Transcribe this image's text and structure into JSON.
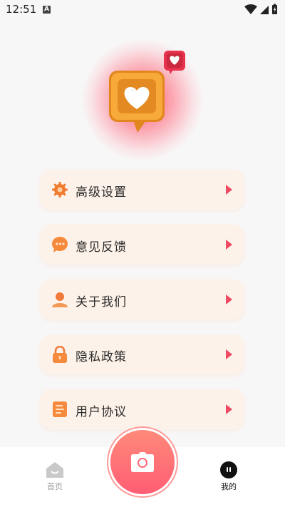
{
  "status_bar": {
    "time": "12:51",
    "notification_glyph": "A"
  },
  "menu": [
    {
      "label": "高级设置",
      "icon": "gear-icon"
    },
    {
      "label": "意见反馈",
      "icon": "chat-bubble-icon"
    },
    {
      "label": "关于我们",
      "icon": "person-icon"
    },
    {
      "label": "隐私政策",
      "icon": "lock-icon"
    },
    {
      "label": "用户协议",
      "icon": "document-icon"
    }
  ],
  "bottom_nav": {
    "home_label": "首页",
    "mine_label": "我的"
  },
  "colors": {
    "accent": "#ee4a63",
    "card_bg": "#fdf2e9",
    "icon_orange": "#f89a4a"
  }
}
